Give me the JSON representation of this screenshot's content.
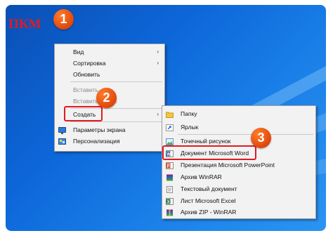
{
  "annotation": {
    "label": "ПКМ",
    "steps": [
      "1",
      "2",
      "3"
    ]
  },
  "context_menu": {
    "items": [
      {
        "label": "Вид",
        "submenu": true
      },
      {
        "label": "Сортировка",
        "submenu": true
      },
      {
        "label": "Обновить"
      },
      {
        "label": "Вставить",
        "disabled": true
      },
      {
        "label": "Вставить ярлык",
        "disabled": true
      },
      {
        "label": "Создать",
        "submenu": true
      },
      {
        "label": "Параметры экрана",
        "icon": "display-icon"
      },
      {
        "label": "Персонализация",
        "icon": "personalize-icon"
      }
    ]
  },
  "submenu": {
    "items": [
      {
        "label": "Папку",
        "icon": "folder-icon"
      },
      {
        "label": "Ярлык",
        "icon": "shortcut-icon"
      },
      {
        "label": "Точечный рисунок",
        "icon": "bitmap-icon"
      },
      {
        "label": "Документ Microsoft Word",
        "icon": "word-icon"
      },
      {
        "label": "Презентация Microsoft PowerPoint",
        "icon": "powerpoint-icon"
      },
      {
        "label": "Архив WinRAR",
        "icon": "winrar-icon"
      },
      {
        "label": "Текстовый документ",
        "icon": "text-document-icon"
      },
      {
        "label": "Лист Microsoft Excel",
        "icon": "excel-icon"
      },
      {
        "label": "Архив ZIP - WinRAR",
        "icon": "zip-icon"
      }
    ]
  },
  "colors": {
    "accent": "#e11a22",
    "badge": "#e24b0c",
    "desktop": "#0d66d8"
  }
}
